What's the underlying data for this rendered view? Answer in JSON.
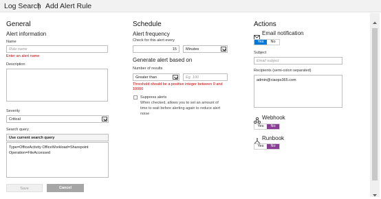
{
  "breadcrumb": {
    "root": "Log Search",
    "separator": "|",
    "current": "Add Alert Rule"
  },
  "general": {
    "title": "General",
    "alert_info_title": "Alert information",
    "name_label": "Name",
    "name_placeholder": "Rule name",
    "name_error": "Enter an alert name",
    "description_label": "Description",
    "severity_label": "Severity",
    "severity_value": "Critical",
    "search_query_label": "Search query",
    "search_query_mode": "Use current search query",
    "query_line1": "Type=OfficeActivity OfficeWorkload=Sharepoint",
    "query_line2": "Operation=FileAccessed",
    "save_label": "Save",
    "cancel_label": "Cancel"
  },
  "schedule": {
    "title": "Schedule",
    "frequency_title": "Alert frequency",
    "check_label": "Check for this alert every",
    "interval_value": "15",
    "interval_unit": "Minutes",
    "generate_title": "Generate alert based on",
    "results_label": "Number of results",
    "comparator": "Greater than",
    "threshold_placeholder": "Eg. 100",
    "threshold_error_line1": "Threshold should be a positive integer between 0 and",
    "threshold_error_line2": "10000",
    "suppress_label": "Suppress alerts",
    "suppress_note_line1": "When checked, allows you to set an amount of",
    "suppress_note_line2": "time to wait before alerting again to reduce alert",
    "suppress_note_line3": "noise"
  },
  "actions": {
    "title": "Actions",
    "email_title": "Email notification",
    "email_yes": "Yes",
    "email_no": "No",
    "subject_label": "Subject",
    "subject_placeholder": "Email subject",
    "recipients_label": "Recipients (semi-colon separated)",
    "recipients_value": "admin@ciaops365.com",
    "webhook_title": "Webhook",
    "webhook_yes": "Yes",
    "webhook_no": "No",
    "runbook_title": "Runbook",
    "runbook_yes": "Yes",
    "runbook_no": "No"
  },
  "colors": {
    "accent_blue": "#0078d7",
    "accent_purple": "#8a3c97",
    "error_red": "#c00000"
  },
  "icons": [
    "mail-icon",
    "webhook-icon",
    "runbook-icon",
    "chevron-down-icon",
    "scroll-up-icon",
    "scroll-down-icon"
  ]
}
